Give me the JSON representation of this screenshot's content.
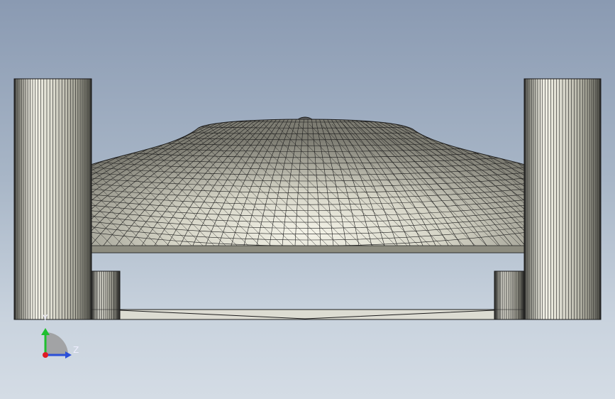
{
  "viewport": {
    "background_top": "#8a9ab2",
    "background_bottom": "#d4dce5"
  },
  "model": {
    "mesh_line_color": "#1c1c1c",
    "surface_light": "#ecebe0",
    "surface_dark": "#6c6c62",
    "parts": [
      "left-cylinder",
      "right-cylinder",
      "dome-canopy",
      "left-block",
      "right-block",
      "base-plate"
    ]
  },
  "triad": {
    "y_label": "Y",
    "z_label": "Z",
    "x_color": "#e01b24",
    "y_color": "#1fbf2f",
    "z_color": "#2b4fd8"
  }
}
